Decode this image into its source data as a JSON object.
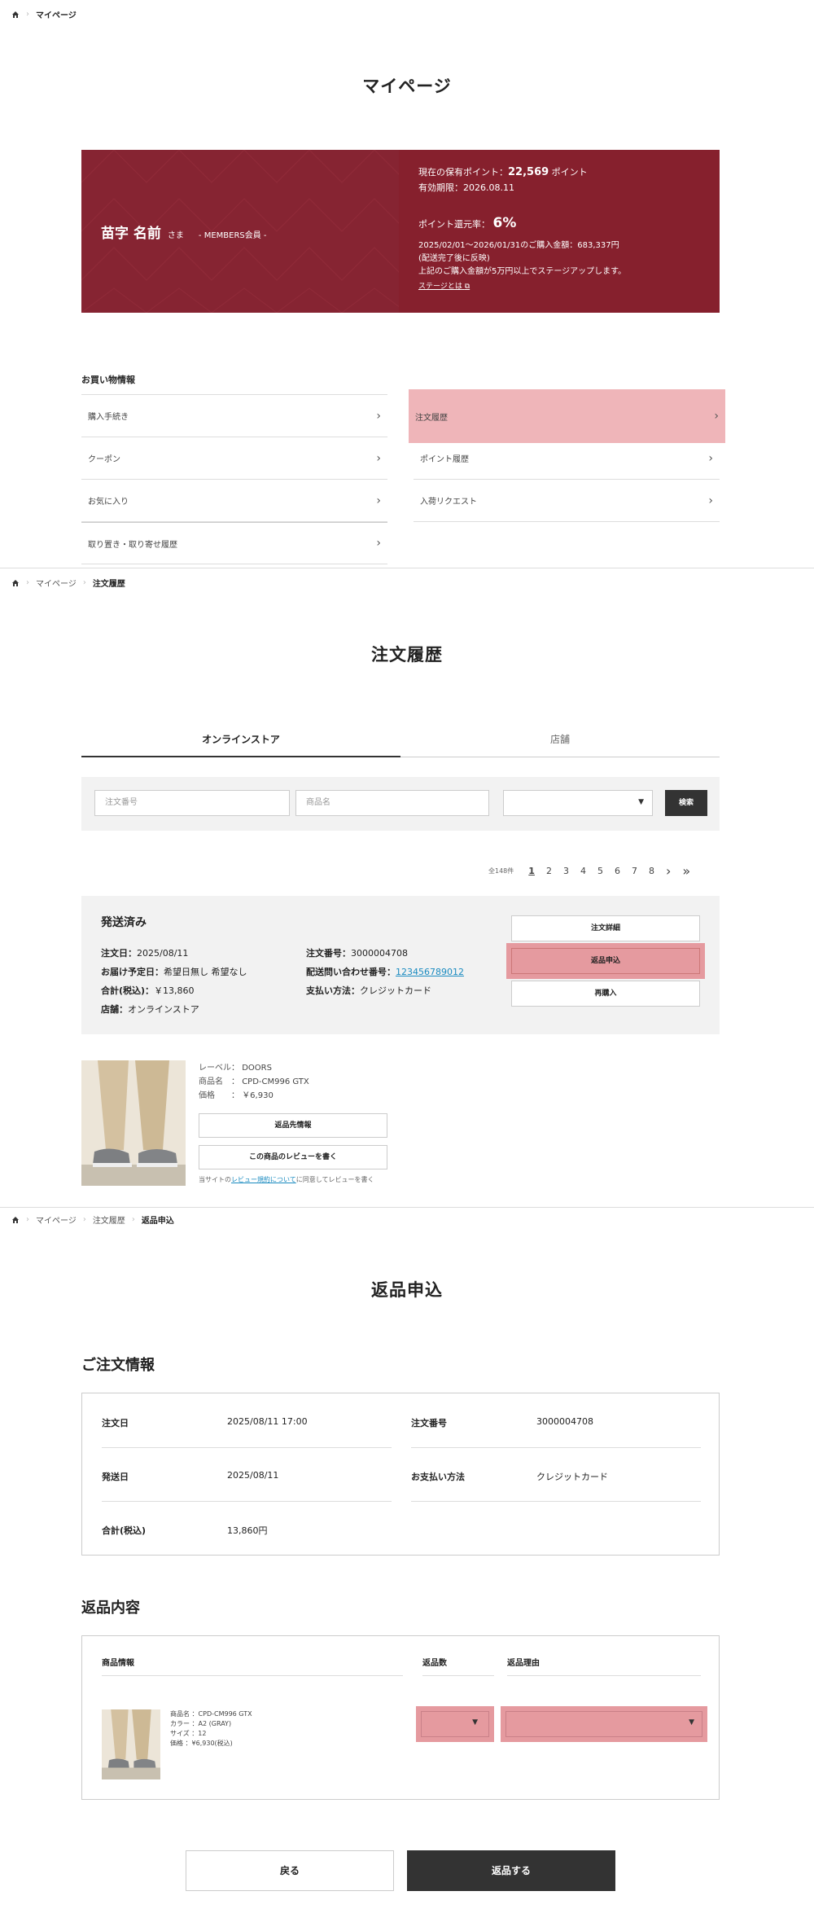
{
  "mypage": {
    "breadcrumb": [
      "マイページ"
    ],
    "title": "マイページ",
    "card": {
      "name": "苗字 名前",
      "honorific": "さま",
      "rank": "- MEMBERS会員 -",
      "points_prefix": "現在の保有ポイント：",
      "points_value": "22,569",
      "points_suffix": " ポイント",
      "expiry": "有効期限：2026.08.11",
      "rate_label": "ポイント還元率：",
      "rate_value": "6%",
      "period_line": "2025/02/01〜2026/01/31のご購入金額：683,337円",
      "note1": "(配送完了後に反映)",
      "note2": "上記のご購入金額が5万円以上でステージアップします。",
      "stage_link": "ステージとは"
    },
    "menu_heading": "お買い物情報",
    "menu_left": [
      "購入手続き",
      "クーポン",
      "お気に入り",
      "取り置き・取り寄せ履歴"
    ],
    "menu_right": [
      "注文履歴",
      "ポイント履歴",
      "入荷リクエスト"
    ]
  },
  "history": {
    "breadcrumb": [
      "マイページ",
      "注文履歴"
    ],
    "title": "注文履歴",
    "tabs": [
      "オンラインストア",
      "店舗"
    ],
    "search": {
      "order_no_placeholder": "注文番号",
      "product_placeholder": "商品名",
      "button": "検索"
    },
    "pager": {
      "count": "全148件",
      "pages": [
        "1",
        "2",
        "3",
        "4",
        "5",
        "6",
        "7",
        "8"
      ],
      "next": "›",
      "last": "»"
    },
    "order": {
      "status": "発送済み",
      "order_date_label": "注文日：",
      "order_date": "2025/08/11",
      "delivery_label": "お届け予定日：",
      "delivery": "希望日無し 希望なし",
      "total_label": "合計(税込)：",
      "total": "￥13,860",
      "store_label": "店舗：",
      "store": "オンラインストア",
      "order_no_label": "注文番号：",
      "order_no": "3000004708",
      "tracking_label": "配送問い合わせ番号：",
      "tracking": "123456789012",
      "payment_label": "支払い方法：",
      "payment": "クレジットカード",
      "btn_detail": "注文詳細",
      "btn_return": "返品申込",
      "btn_rebuy": "再購入"
    },
    "product": {
      "label_k": "レーベル",
      "label_v": "DOORS",
      "name_k": "商品名",
      "name_v": "CPD-CM996 GTX",
      "price_k": "価格",
      "price_v": "￥6,930",
      "btn_return_info": "返品先情報",
      "btn_review": "この商品のレビューを書く",
      "review_note_pre": "当サイトの",
      "review_note_link": "レビュー規約について",
      "review_note_post": "に同意してレビューを書く"
    }
  },
  "return": {
    "breadcrumb": [
      "マイページ",
      "注文履歴",
      "返品申込"
    ],
    "title": "返品申込",
    "order_info_title": "ご注文情報",
    "order_date_k": "注文日",
    "order_date_v": "2025/08/11 17:00",
    "order_no_k": "注文番号",
    "order_no_v": "3000004708",
    "ship_date_k": "発送日",
    "ship_date_v": "2025/08/11",
    "payment_k": "お支払い方法",
    "payment_v": "クレジットカード",
    "total_k": "合計(税込)",
    "total_v": "13,860円",
    "content_title": "返品内容",
    "col_product": "商品情報",
    "col_qty": "返品数",
    "col_reason": "返品理由",
    "item": {
      "name": "商品名 ：CPD-CM996 GTX",
      "color": "カラー ：A2 (GRAY)",
      "size": "サイズ ：12",
      "price": "価格 ：¥6,930(税込)"
    },
    "btn_back": "戻る",
    "btn_submit": "返品する"
  },
  "colors": {
    "card_left": "#862432",
    "card_right": "#86202d",
    "highlight": "#e59a9f",
    "dark_button": "#333333",
    "link": "#1a8bc0"
  }
}
